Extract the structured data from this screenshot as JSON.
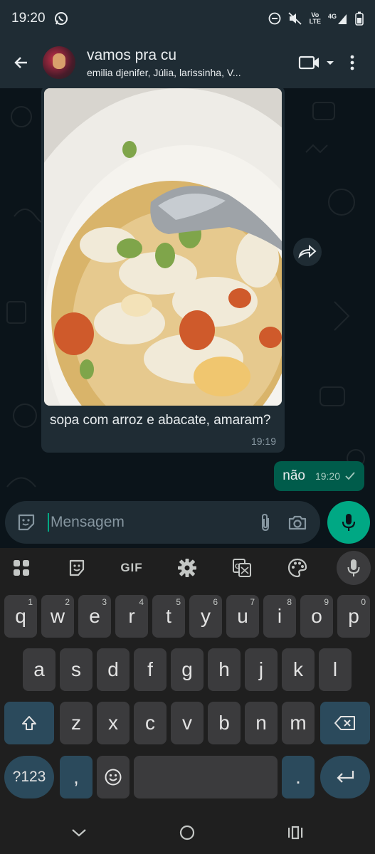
{
  "status_bar": {
    "time": "19:20",
    "network_label": "Vo \nLTE",
    "network_type": "4G"
  },
  "header": {
    "title": "vamos pra cu",
    "members": "emilia djenifer, Júlia, larissinha, V..."
  },
  "messages": {
    "incoming": {
      "caption": "sopa com arroz e abacate, amaram?",
      "time": "19:19",
      "type": "image"
    },
    "outgoing": {
      "text": "não",
      "time": "19:20",
      "status": "sent"
    }
  },
  "composer": {
    "placeholder": "Mensagem"
  },
  "keyboard": {
    "toolbar": {
      "gif_label": "GIF"
    },
    "row1": [
      {
        "k": "q",
        "h": "1"
      },
      {
        "k": "w",
        "h": "2"
      },
      {
        "k": "e",
        "h": "3"
      },
      {
        "k": "r",
        "h": "4"
      },
      {
        "k": "t",
        "h": "5"
      },
      {
        "k": "y",
        "h": "6"
      },
      {
        "k": "u",
        "h": "7"
      },
      {
        "k": "i",
        "h": "8"
      },
      {
        "k": "o",
        "h": "9"
      },
      {
        "k": "p",
        "h": "0"
      }
    ],
    "row2": [
      "a",
      "s",
      "d",
      "f",
      "g",
      "h",
      "j",
      "k",
      "l"
    ],
    "row3": [
      "z",
      "x",
      "c",
      "v",
      "b",
      "n",
      "m"
    ],
    "symbols_label": "?123",
    "comma": ",",
    "period": "."
  },
  "colors": {
    "accent": "#00a884",
    "outgoing_bubble": "#005c4b",
    "bubble": "#1f2c34",
    "background": "#0b141a"
  },
  "icons": [
    "whatsapp-icon",
    "dnd-icon",
    "mute-icon",
    "signal-icon",
    "battery-icon",
    "back-arrow-icon",
    "video-call-icon",
    "more-icon",
    "forward-icon",
    "sticker-icon",
    "attach-icon",
    "camera-icon",
    "mic-icon",
    "apps-grid-icon",
    "clipboard-icon",
    "settings-icon",
    "translate-icon",
    "palette-icon",
    "shift-icon",
    "backspace-icon",
    "emoji-icon",
    "enter-icon"
  ]
}
